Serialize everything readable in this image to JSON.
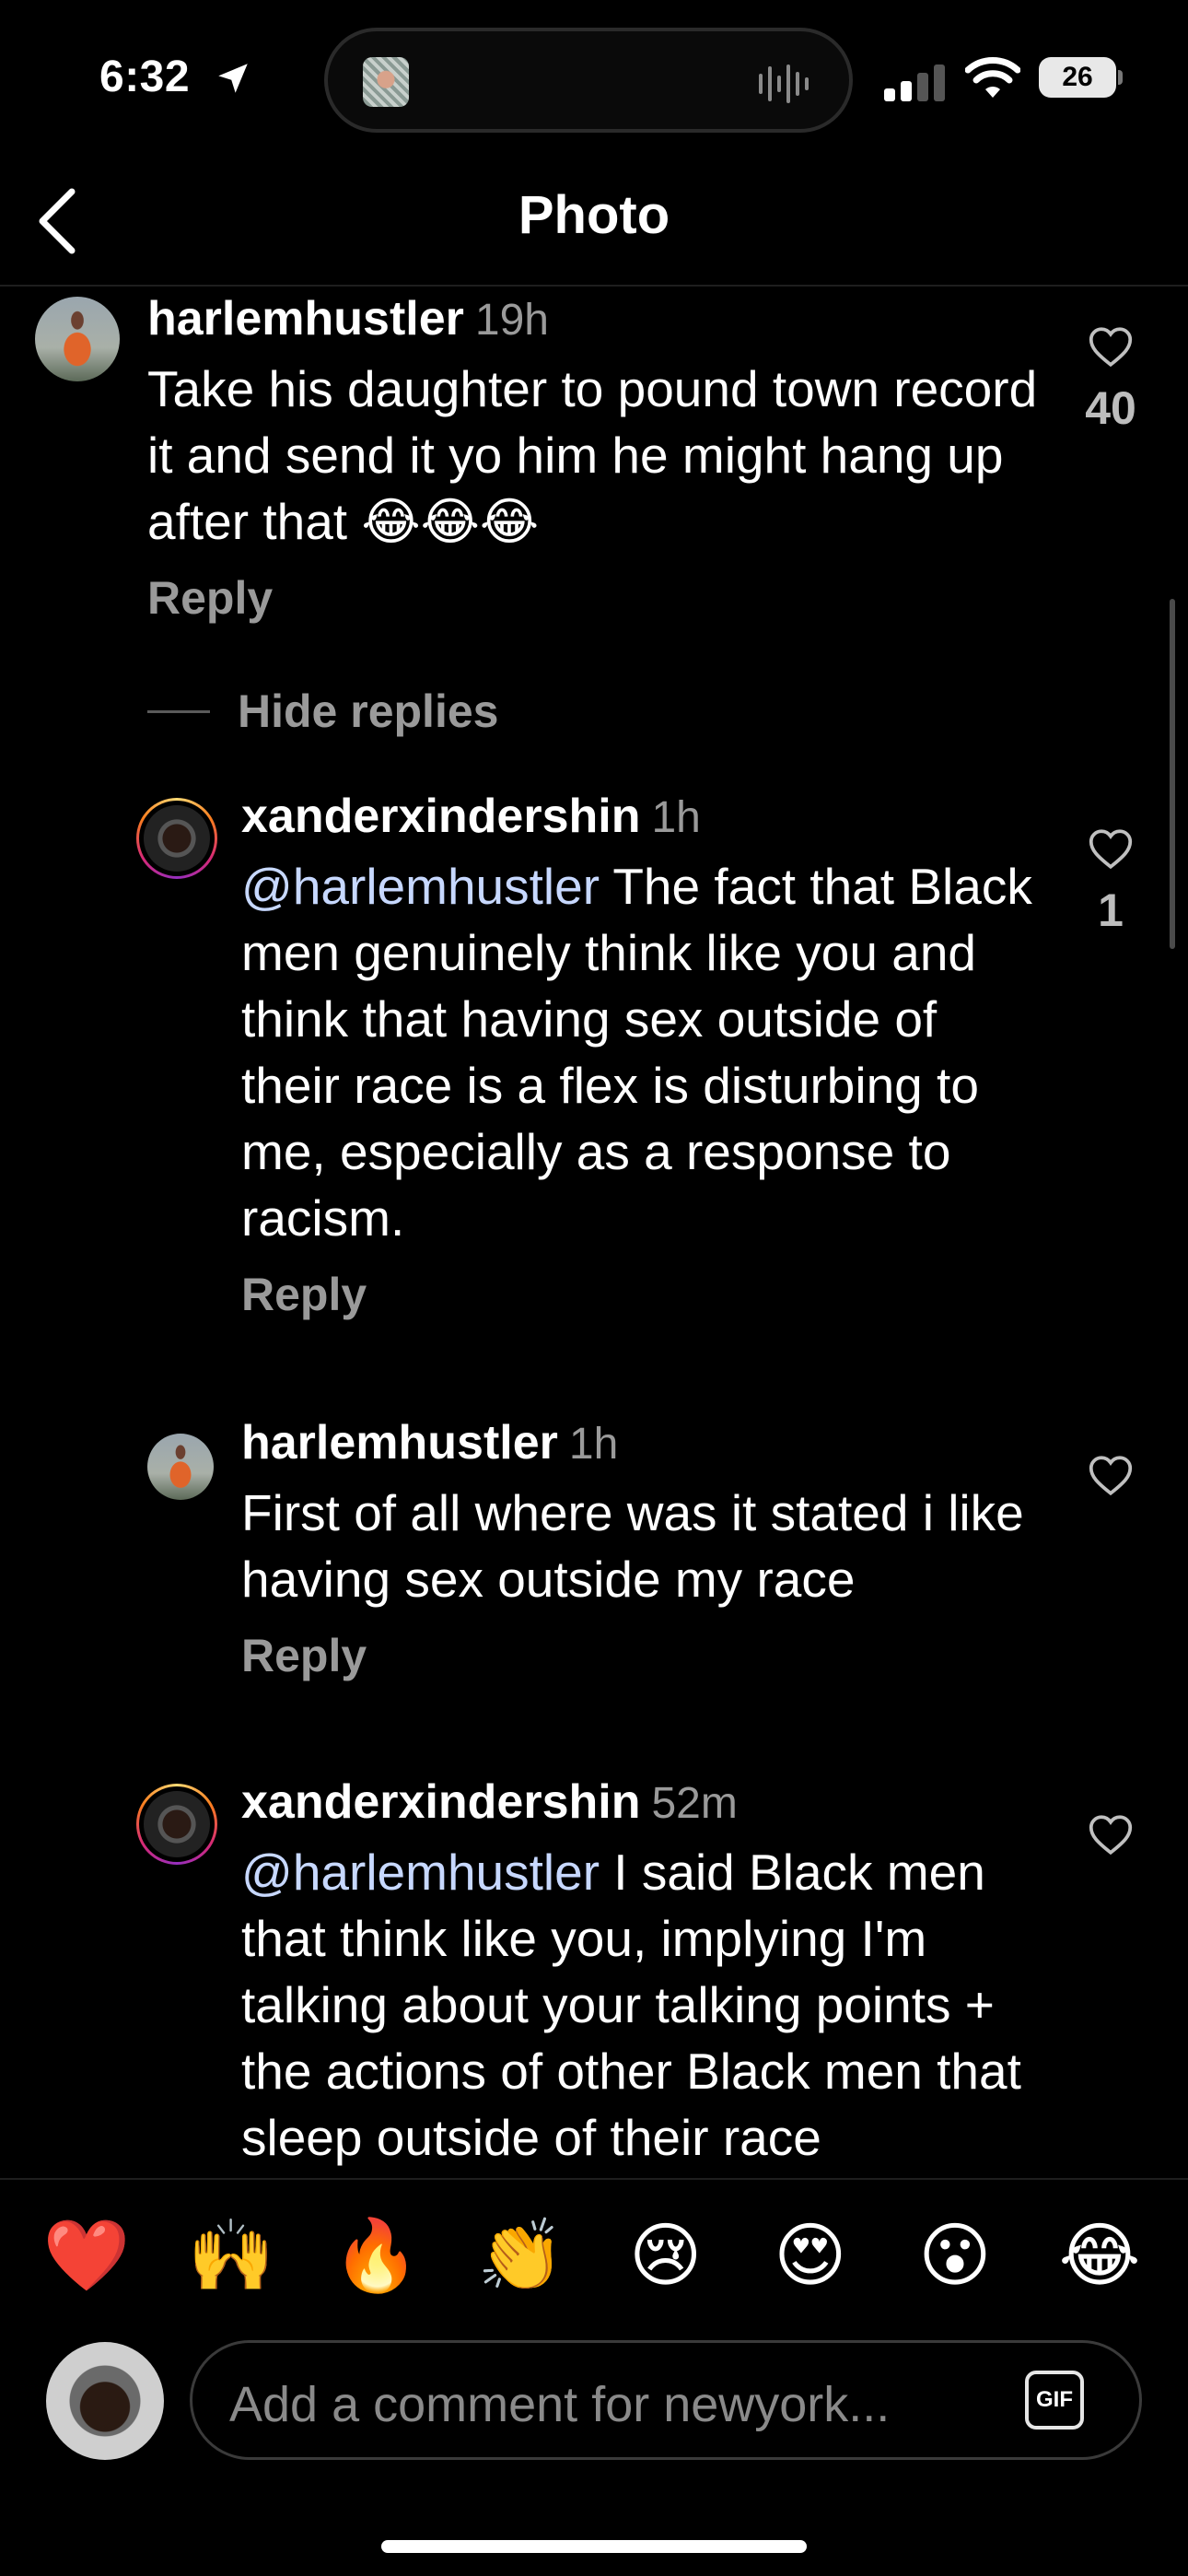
{
  "status_bar": {
    "time": "6:32",
    "battery": "26"
  },
  "header": {
    "title": "Photo"
  },
  "comments": [
    {
      "username": "harlemhustler",
      "time": "19h",
      "text": "Take his daughter to pound town record it and send it yo him he might hang up after that 😂😂😂",
      "reply_label": "Reply",
      "likes": "40"
    },
    {
      "username": "xanderxindershin",
      "time": "1h",
      "mention": "@harlemhustler",
      "text": " The fact that Black men genuinely think like you and think that having sex outside of their race is a flex is disturbing to me, especially as a response to racism.",
      "reply_label": "Reply",
      "likes": "1"
    },
    {
      "username": "harlemhustler",
      "time": "1h",
      "text": "First of all where was it stated i like having sex outside my race",
      "reply_label": "Reply"
    },
    {
      "username": "xanderxindershin",
      "time": "52m",
      "mention": "@harlemhustler",
      "text": " I said Black men that think like you, implying I'm talking about your talking points + the actions of other Black men that sleep outside of their race"
    }
  ],
  "hide_replies": "Hide replies",
  "reactions": [
    "❤️",
    "🙌",
    "🔥",
    "👏",
    "😢",
    "😍",
    "😮",
    "😂"
  ],
  "composer": {
    "placeholder": "Add a comment for newyork...",
    "gif_label": "GIF"
  },
  "icons": {
    "back": "chevron-left-icon",
    "like": "heart-outline-icon",
    "location": "location-arrow-icon"
  }
}
